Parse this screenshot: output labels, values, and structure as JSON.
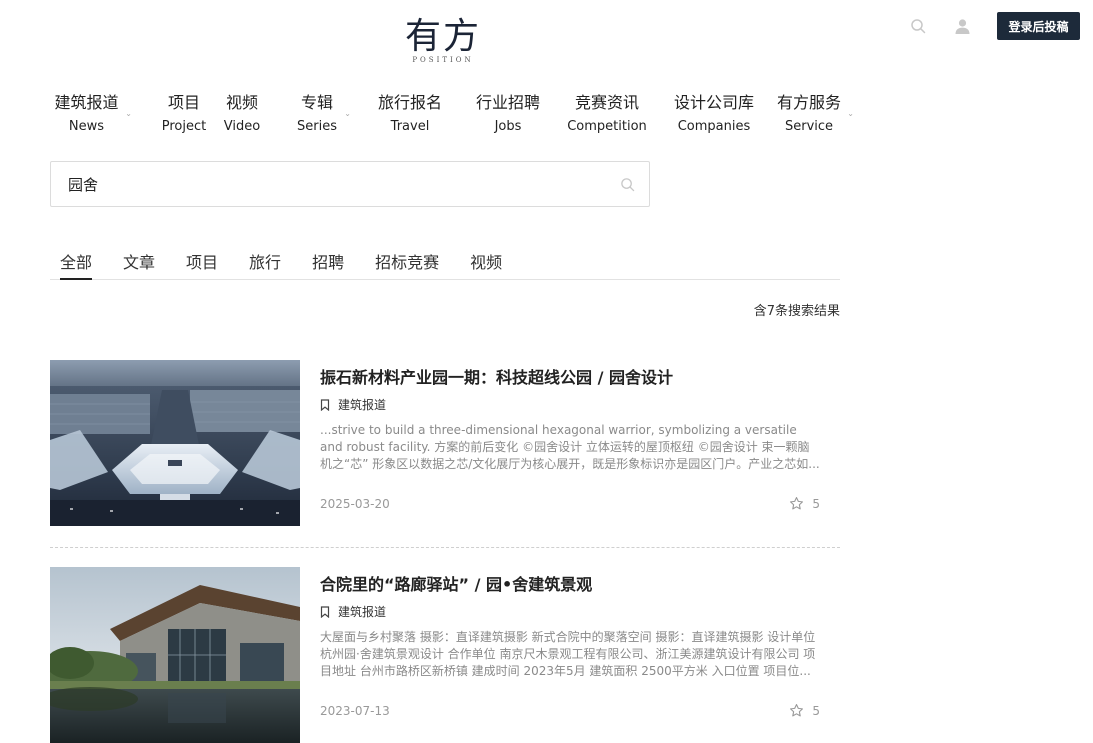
{
  "logo": {
    "cn": "有方",
    "en": "POSITION"
  },
  "header": {
    "login_label": "登录后投稿"
  },
  "nav": [
    {
      "cn": "建筑报道",
      "en": "News",
      "dropdown": true
    },
    {
      "cn": "项目",
      "en": "Project",
      "dropdown": false
    },
    {
      "cn": "视频",
      "en": "Video",
      "dropdown": false
    },
    {
      "cn": "专辑",
      "en": "Series",
      "dropdown": true
    },
    {
      "cn": "旅行报名",
      "en": "Travel",
      "dropdown": false
    },
    {
      "cn": "行业招聘",
      "en": "Jobs",
      "dropdown": false
    },
    {
      "cn": "竞赛资讯",
      "en": "Competition",
      "dropdown": false
    },
    {
      "cn": "设计公司库",
      "en": "Companies",
      "dropdown": false
    },
    {
      "cn": "有方服务",
      "en": "Service",
      "dropdown": true
    }
  ],
  "search": {
    "value": "园舍"
  },
  "tabs": [
    "全部",
    "文章",
    "项目",
    "旅行",
    "招聘",
    "招标竞赛",
    "视频"
  ],
  "active_tab": 0,
  "result_count": "含7条搜索结果",
  "results": [
    {
      "title": "振石新材料产业园一期：科技超线公园 / 园舍设计",
      "category": "建筑报道",
      "desc": "...strive to build a three-dimensional hexagonal warrior, symbolizing a versatile and robust facility.   方案的前后变化 ©园舍设计 立体运转的屋顶枢纽 ©园舍设计 束一颗脑机之“芯”   形象区以数据之芯/文化展厅为核心展开，既是形象标识亦是园区门户。产业之芯如...",
      "date": "2025-03-20",
      "favorites": "5"
    },
    {
      "title": "合院里的“路廊驿站” / 园•舍建筑景观",
      "category": "建筑报道",
      "desc": "大屋面与乡村聚落 摄影：直译建筑摄影 新式合院中的聚落空间 摄影：直译建筑摄影 设计单位 杭州园·舍建筑景观设计 合作单位 南京尺木景观工程有限公司、浙江美源建筑设计有限公司 项目地址 台州市路桥区新桥镇 建成时间 2023年5月 建筑面积 2500平方米   入口位置   项目位...",
      "date": "2023-07-13",
      "favorites": "5"
    }
  ]
}
